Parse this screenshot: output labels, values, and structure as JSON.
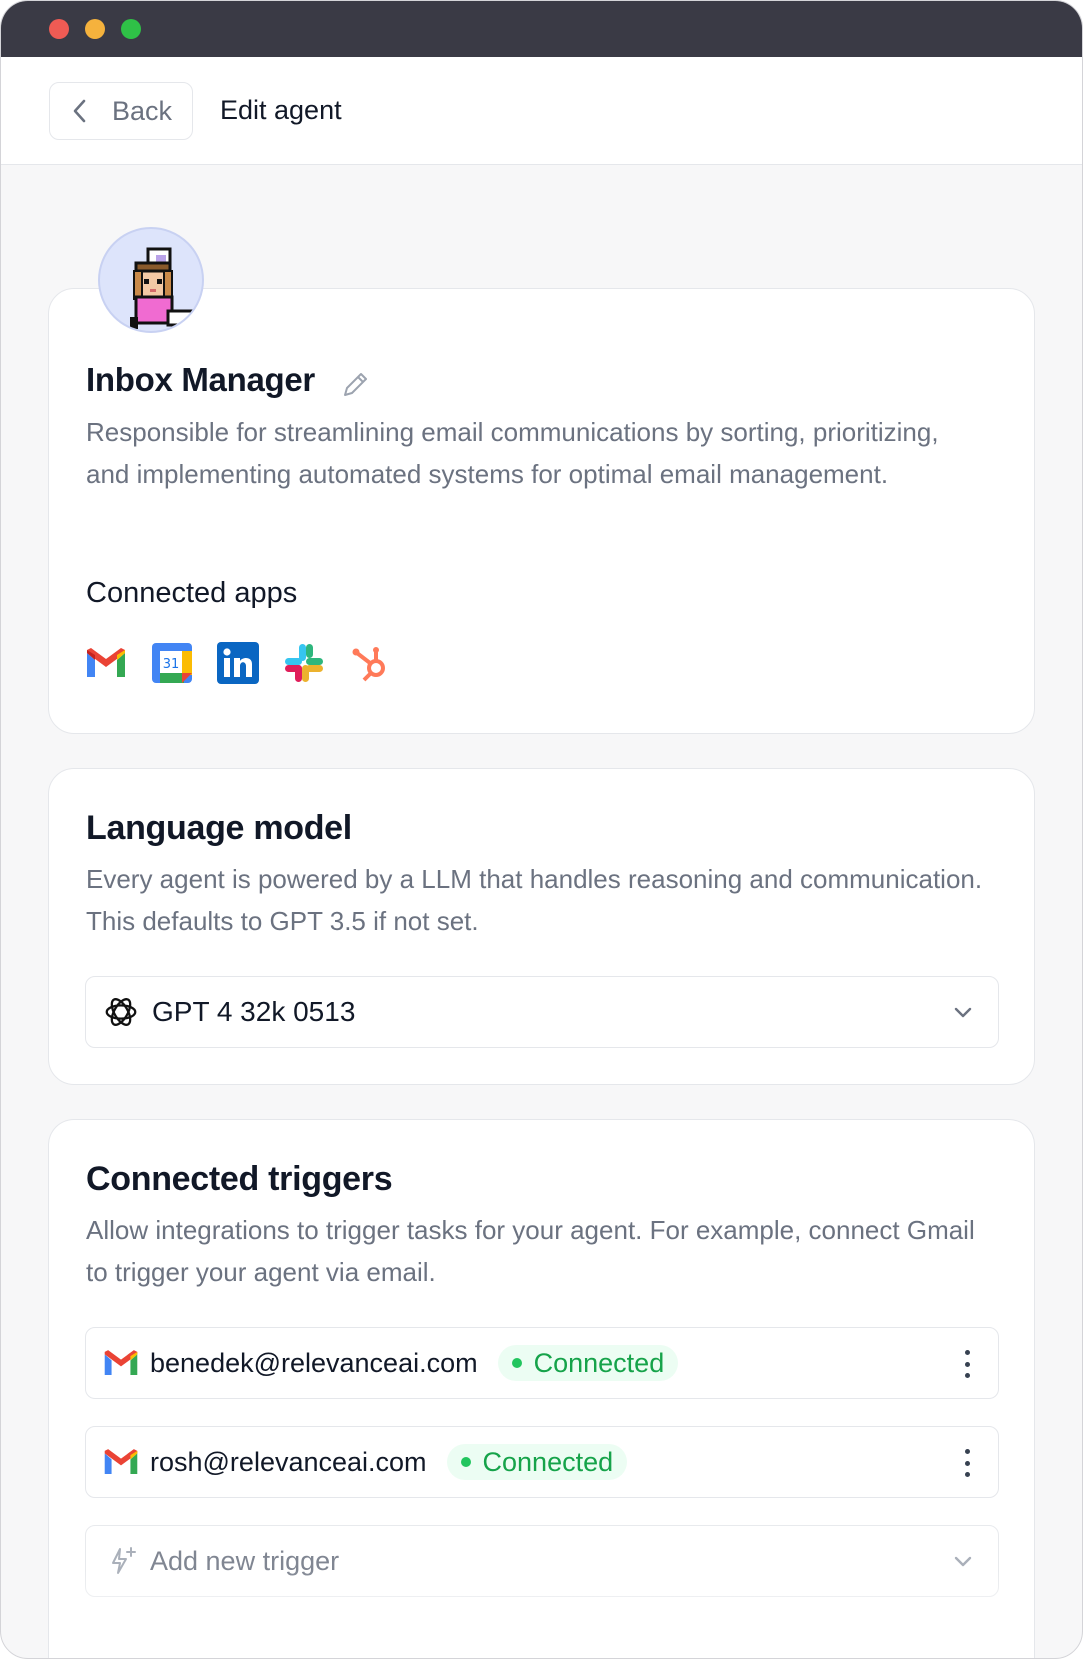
{
  "header": {
    "back_label": "Back",
    "page_title": "Edit agent"
  },
  "agent": {
    "name": "Inbox Manager",
    "description": "Responsible for streamlining email communications by sorting, prioritizing, and implementing automated systems for optimal email management.",
    "connected_apps_label": "Connected apps",
    "apps": [
      "gmail-icon",
      "google-calendar-icon",
      "linkedin-icon",
      "slack-icon",
      "hubspot-icon"
    ],
    "calendar_day": "31"
  },
  "language_model": {
    "title": "Language model",
    "description": "Every agent is powered by a LLM that handles reasoning and communication. This defaults to GPT 3.5 if not set.",
    "selected": "GPT 4 32k 0513"
  },
  "triggers": {
    "title": "Connected triggers",
    "description": "Allow integrations to trigger tasks for your agent. For example, connect Gmail to trigger your agent via email.",
    "items": [
      {
        "email": "benedek@relevanceai.com",
        "status": "Connected"
      },
      {
        "email": "rosh@relevanceai.com",
        "status": "Connected"
      }
    ],
    "add_label": "Add new trigger"
  },
  "colors": {
    "titlebar": "#3a3a45",
    "status_green": "#16a34a",
    "badge_bg": "#ecfdf3"
  }
}
